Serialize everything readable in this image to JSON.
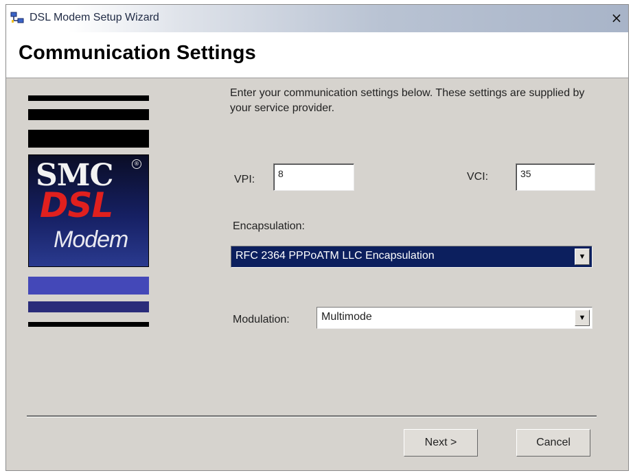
{
  "window": {
    "title": "DSL Modem Setup Wizard",
    "close_glyph": "×"
  },
  "header": {
    "title": "Communication Settings"
  },
  "logo": {
    "brand": "SMC",
    "registered": "®",
    "product": "DSL",
    "sub": "Modem"
  },
  "description": "Enter your communication settings below.  These settings are supplied by your service provider.",
  "vpi": {
    "label": "VPI:",
    "value": "8"
  },
  "vci": {
    "label": "VCI:",
    "value": "35"
  },
  "encapsulation": {
    "label": "Encapsulation:",
    "value": "RFC 2364 PPPoATM LLC Encapsulation"
  },
  "modulation": {
    "label": "Modulation:",
    "value": "Multimode"
  },
  "buttons": {
    "next": "Next >",
    "cancel": "Cancel"
  },
  "colors": {
    "accent": "#0c1f5e",
    "logo_red": "#e0201e",
    "stripe_blue": "#4448b8",
    "dialog_bg": "#d6d3ce"
  }
}
